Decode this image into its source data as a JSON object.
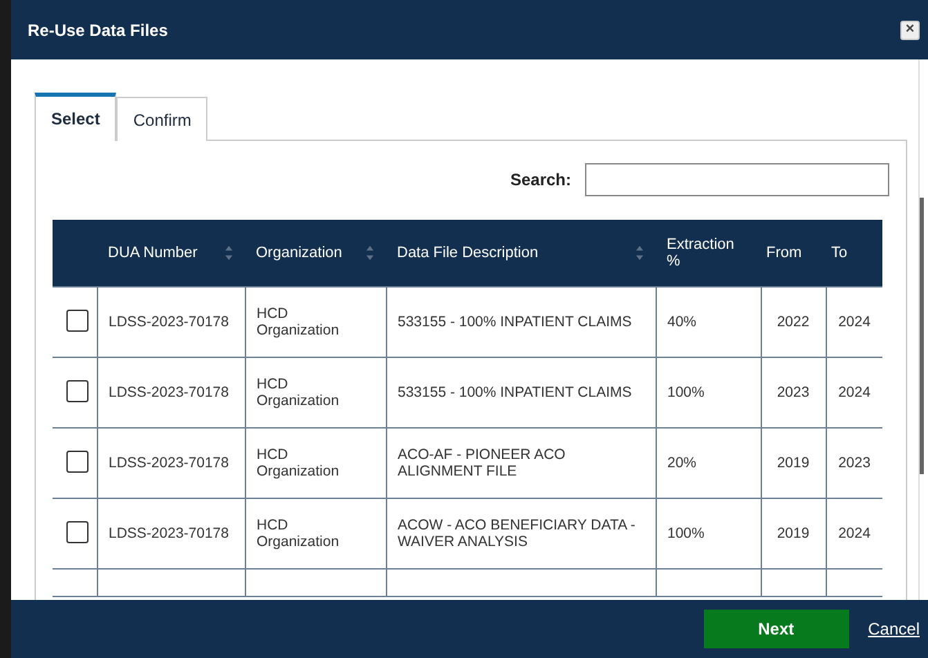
{
  "window": {
    "title": "Re-Use Data Files",
    "close": "×"
  },
  "tabs": [
    {
      "label": "Select",
      "selected": true
    },
    {
      "label": "Confirm",
      "selected": false
    }
  ],
  "search": {
    "label": "Search:"
  },
  "table": {
    "columns": [
      {
        "label": "DUA Number",
        "sortable": true
      },
      {
        "label": "Organization",
        "sortable": true
      },
      {
        "label": "Data File Description",
        "sortable": true
      },
      {
        "label": "Extraction %",
        "sortable": false
      },
      {
        "label": "From",
        "sortable": false
      },
      {
        "label": "To",
        "sortable": false
      }
    ],
    "rows": [
      {
        "checked": false,
        "cells": [
          "LDSS-2023-70178",
          "HCD Organization",
          "533155 - 100% INPATIENT CLAIMS",
          "40%",
          "2022",
          "2024"
        ]
      },
      {
        "checked": false,
        "cells": [
          "LDSS-2023-70178",
          "HCD Organization",
          "533155 - 100% INPATIENT CLAIMS",
          "100%",
          "2023",
          "2024"
        ]
      },
      {
        "checked": false,
        "cells": [
          "LDSS-2023-70178",
          "HCD Organization",
          "ACO-AF - PIONEER ACO ALIGNMENT FILE",
          "20%",
          "2019",
          "2023"
        ]
      },
      {
        "checked": false,
        "cells": [
          "LDSS-2023-70178",
          "HCD Organization",
          "ACOW - ACO BENEFICIARY DATA - WAIVER ANALYSIS",
          "100%",
          "2019",
          "2024"
        ]
      }
    ]
  },
  "footer": {
    "primary": "Next",
    "secondary": "Cancel"
  }
}
